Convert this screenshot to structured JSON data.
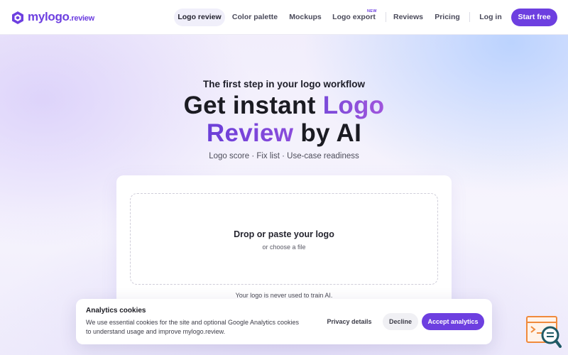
{
  "brand": {
    "name": "mylogo",
    "tld": ".review",
    "accent": "#6d3fe0"
  },
  "nav": {
    "items": [
      {
        "label": "Logo review",
        "active": true
      },
      {
        "label": "Color palette"
      },
      {
        "label": "Mockups"
      },
      {
        "label": "Logo export",
        "badge": "NEW"
      },
      {
        "label": "Reviews"
      },
      {
        "label": "Pricing"
      }
    ],
    "login": "Log in",
    "cta": "Start free"
  },
  "hero": {
    "eyebrow": "The first step in your logo workflow",
    "title_part1": "Get instant",
    "title_highlight1": "Logo",
    "title_highlight2": "Review",
    "title_part2": "by AI",
    "features": "Logo score · Fix list · Use-case readiness"
  },
  "upload": {
    "title": "Drop or paste your logo",
    "subtitle": "or choose a file",
    "privacy_note": "Your logo is never used to train AI."
  },
  "cookie": {
    "title": "Analytics cookies",
    "text": "We use essential cookies for the site and optional Google Analytics cookies to understand usage and improve mylogo.review.",
    "privacy_label": "Privacy details",
    "decline_label": "Decline",
    "accept_label": "Accept analytics"
  },
  "icons": {
    "logo": "mylogo-hexagon-icon",
    "widget": "search-document-icon"
  }
}
